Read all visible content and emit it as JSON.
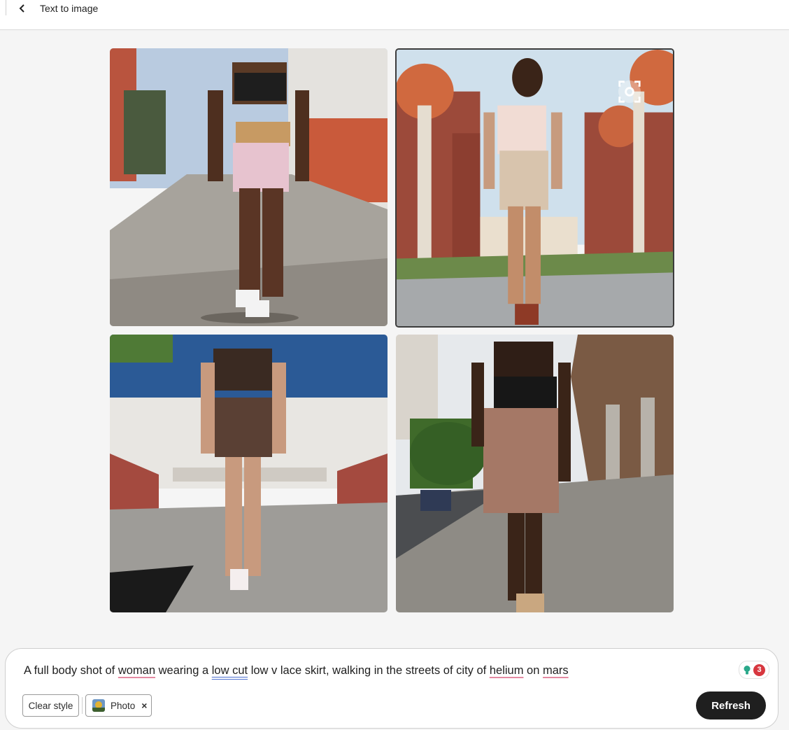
{
  "header": {
    "title": "Text to image",
    "back_icon": "chevron-left-icon"
  },
  "images": [
    {
      "selected": false
    },
    {
      "selected": true,
      "overlay_icon": "focus-frame-icon"
    },
    {
      "selected": false
    },
    {
      "selected": false
    }
  ],
  "prompt": {
    "segments": [
      {
        "text": "A full body shot of ",
        "mark": "none"
      },
      {
        "text": "woman",
        "mark": "spelling"
      },
      {
        "text": " wearing a ",
        "mark": "none"
      },
      {
        "text": "low cut",
        "mark": "grammar"
      },
      {
        "text": " low v lace skirt, walking in the streets of city of ",
        "mark": "none"
      },
      {
        "text": "helium",
        "mark": "spelling"
      },
      {
        "text": " on ",
        "mark": "none"
      },
      {
        "text": "mars",
        "mark": "spelling"
      }
    ],
    "credits_icon": "lightbulb-icon",
    "credits_count": "3"
  },
  "styles": {
    "clear_label": "Clear style",
    "chip_label": "Photo",
    "chip_remove": "×"
  },
  "actions": {
    "refresh_label": "Refresh"
  },
  "colors": {
    "accent_dark": "#1f1f1f",
    "badge_red": "#d7373f",
    "spelling_underline": "#e58aa2",
    "grammar_underline": "#4d6fd0"
  }
}
